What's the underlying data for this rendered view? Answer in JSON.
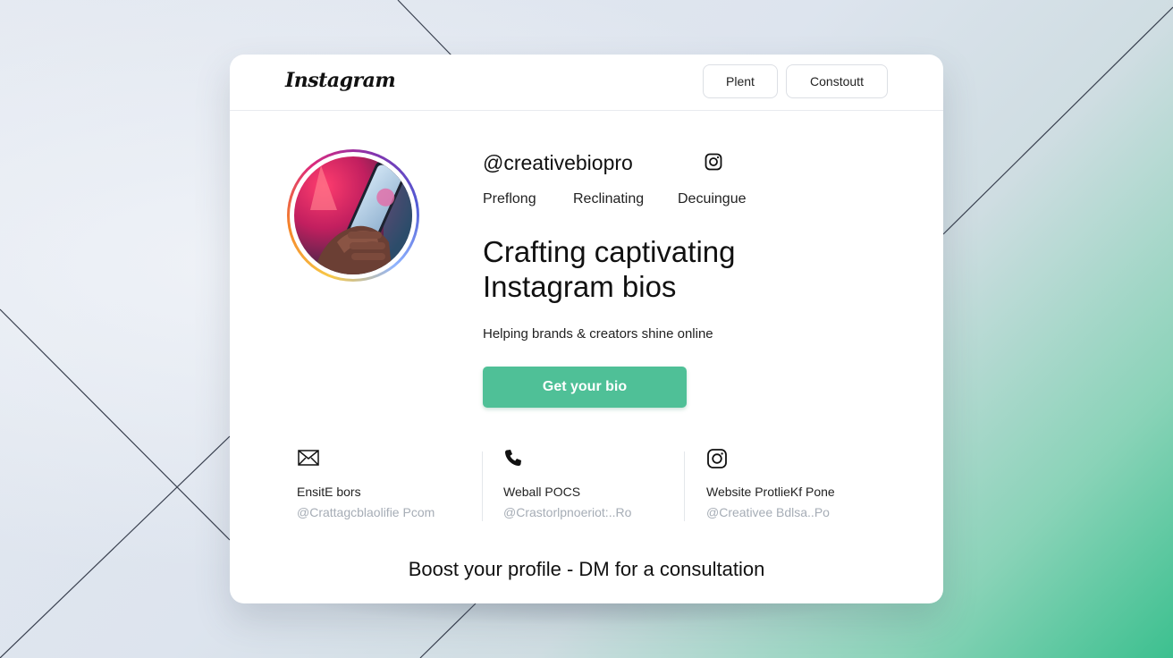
{
  "header": {
    "logo_text": "Instagram",
    "buttons": [
      "Plent",
      "Constoutt"
    ]
  },
  "profile": {
    "handle": "@creativebiopro",
    "handle_icon": "instagram-icon",
    "tabs": [
      "Preflong",
      "Reclinating",
      "Decuingue"
    ],
    "headline": "Crafting captivating Instagram bios",
    "tagline": "Helping brands & creators shine online",
    "cta_label": "Get your bio",
    "avatar": "hand-holding-phone-photo"
  },
  "contacts": [
    {
      "icon": "mail-icon",
      "title": "EnsitE bors",
      "subtitle": "@Crattagcblaolifie Pcom"
    },
    {
      "icon": "phone-icon",
      "title": "Weball POCS",
      "subtitle": "@Crastorlpnoeriot:..Ro"
    },
    {
      "icon": "instagram-icon",
      "title": "Website ProtlieKf Pone",
      "subtitle": "@Creativeе Bdlsa..Po"
    }
  ],
  "footer": {
    "text": "Boost your profile - DM for a consultation"
  },
  "colors": {
    "accent": "#4fc097",
    "background_gradient_end": "#3cc08f",
    "text": "#111111",
    "muted": "#a6adb6"
  }
}
